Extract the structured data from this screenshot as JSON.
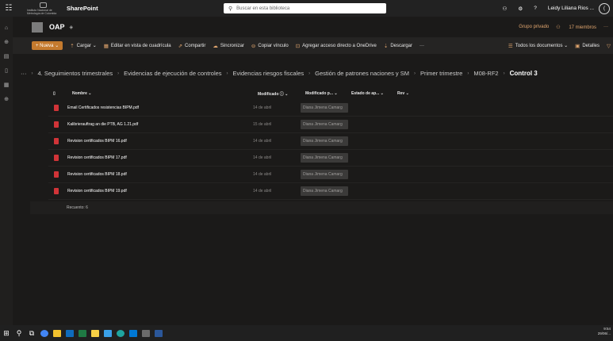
{
  "suite": {
    "org_logo_text": "Instituto Nacional de Metrología de Colombia",
    "app_name": "SharePoint",
    "search_placeholder": "Buscar en esta biblioteca",
    "user_name": "Leidy Liliana Rios ..."
  },
  "site": {
    "title": "OAP",
    "privacy": "Grupo privado",
    "members": "17 miembros"
  },
  "commands": {
    "new": "+ Nueva",
    "upload": "Cargar",
    "grid": "Editar en vista de cuadrícula",
    "share": "Compartir",
    "sync": "Sincronizar",
    "copy_link": "Copiar vínculo",
    "shortcut": "Agregar acceso directo a OneDrive",
    "download": "Descargar",
    "more": "···",
    "view": "Todos los documentos",
    "details": "Detalles"
  },
  "breadcrumb": {
    "ellipsis": "···",
    "items": [
      "4. Seguimientos trimestrales",
      "Evidencias de ejecución de controles",
      "Evidencias riesgos fiscales",
      "Gestión de patrones naciones y SM",
      "Primer trimestre",
      "M08-RF2"
    ],
    "current": "Control 3"
  },
  "columns": {
    "name": "Nombre",
    "modified": "Modificado",
    "modified_by": "Modificado p...",
    "status": "Estado de ap...",
    "rev": "Rev"
  },
  "files": [
    {
      "name": "Email Certificados resistencias BIPM.pdf",
      "modified": "14 de abril",
      "by": "Diana Jimena Camarg"
    },
    {
      "name": "Kalibrierauftrag an die PTB, AG 1.21.pdf",
      "modified": "15 de abril",
      "by": "Diana Jimena Camarg"
    },
    {
      "name": "Revision certificados BIPM 16.pdf",
      "modified": "14 de abril",
      "by": "Diana Jimena Camarg"
    },
    {
      "name": "Revision certificados BIPM 17.pdf",
      "modified": "14 de abril",
      "by": "Diana Jimena Camarg"
    },
    {
      "name": "Revision certificados BIPM 18.pdf",
      "modified": "14 de abril",
      "by": "Diana Jimena Camarg"
    },
    {
      "name": "Revision certificados BIPM 19.pdf",
      "modified": "14 de abril",
      "by": "Diana Jimena Camarg"
    }
  ],
  "count_label": "Recuento: 6",
  "clock": {
    "time": "9:54",
    "date": "29/06/..."
  },
  "colors": {
    "accent": "#c47a2e",
    "pdf": "#d13438"
  }
}
